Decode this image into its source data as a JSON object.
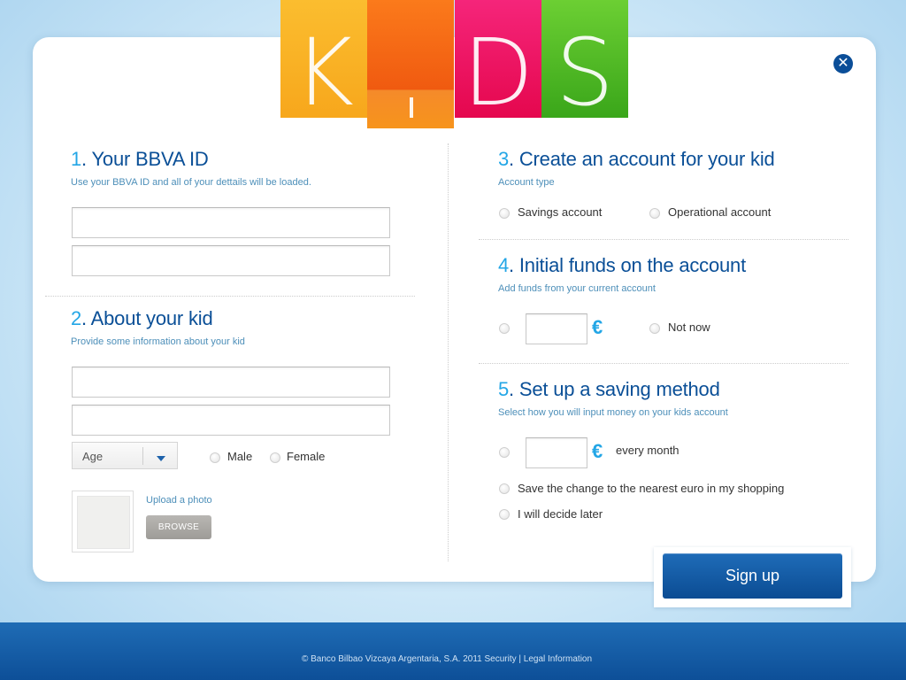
{
  "logo": {
    "letters": [
      "K",
      "",
      "D",
      "S"
    ],
    "colors": [
      "#f7a71c",
      "#f05a10",
      "#e5074e",
      "#3aa61a"
    ]
  },
  "close": {
    "icon": "close-icon",
    "glyph": "✕"
  },
  "section1": {
    "number": "1",
    "title": ". Your BBVA ID",
    "subtitle": "Use your BBVA ID and all of your dettails will be loaded."
  },
  "section2": {
    "number": "2",
    "title": ". About your kid",
    "subtitle": "Provide some information about your kid",
    "age_label": "Age",
    "gender_options": [
      "Male",
      "Female"
    ],
    "upload_label": "Upload a photo",
    "browse_label": "BROWSE"
  },
  "section3": {
    "number": "3",
    "title": ". Create an account for your kid",
    "subtitle": "Account type",
    "options": [
      "Savings account",
      "Operational account"
    ]
  },
  "section4": {
    "number": "4",
    "title": ". Initial funds on the account",
    "subtitle": "Add funds from your current account",
    "currency": "€",
    "not_now": "Not now"
  },
  "section5": {
    "number": "5",
    "title": ". Set up a saving method",
    "subtitle": "Select how you will input money on your kids account",
    "currency": "€",
    "every_month": "every month",
    "options": [
      "Save the change to the nearest euro in my shopping",
      "I will decide later"
    ]
  },
  "signup": {
    "label": "Sign up"
  },
  "footer": {
    "text": "© Banco Bilbao Vizcaya Argentaria, S.A. 2011 Security | Legal Information"
  },
  "theme": {
    "primary": "#0a4f97",
    "accent": "#23a6e6"
  }
}
